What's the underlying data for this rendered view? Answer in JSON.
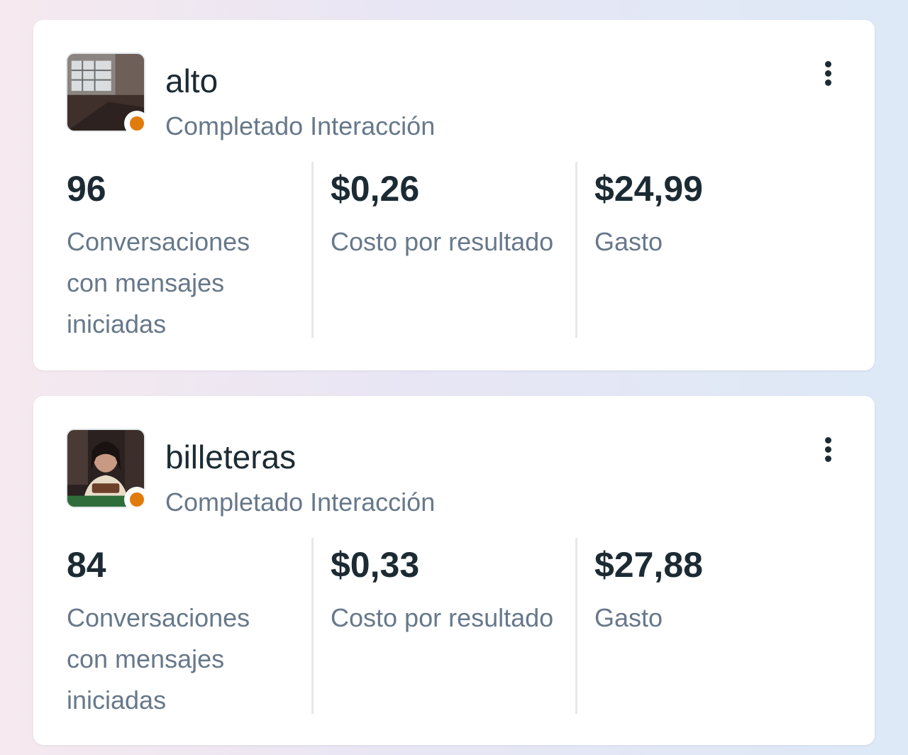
{
  "colors": {
    "status_dot": "#e07b0c",
    "title": "#1c2b33",
    "muted": "#67788a",
    "card_bg": "#ffffff"
  },
  "ads": [
    {
      "name": "alto",
      "status": "Completado",
      "objective": "Interacción",
      "thumbnail_icon": "room-photo-thumbnail",
      "more_icon": "more-vertical-icon",
      "metrics": [
        {
          "value": "96",
          "label": "Conversaciones con mensajes iniciadas"
        },
        {
          "value": "$0,26",
          "label": "Costo por resultado"
        },
        {
          "value": "$24,99",
          "label": "Gasto"
        }
      ]
    },
    {
      "name": "billeteras",
      "status": "Completado",
      "objective": "Interacción",
      "thumbnail_icon": "person-photo-thumbnail",
      "more_icon": "more-vertical-icon",
      "metrics": [
        {
          "value": "84",
          "label": "Conversaciones con mensajes iniciadas"
        },
        {
          "value": "$0,33",
          "label": "Costo por resultado"
        },
        {
          "value": "$27,88",
          "label": "Gasto"
        }
      ]
    }
  ]
}
